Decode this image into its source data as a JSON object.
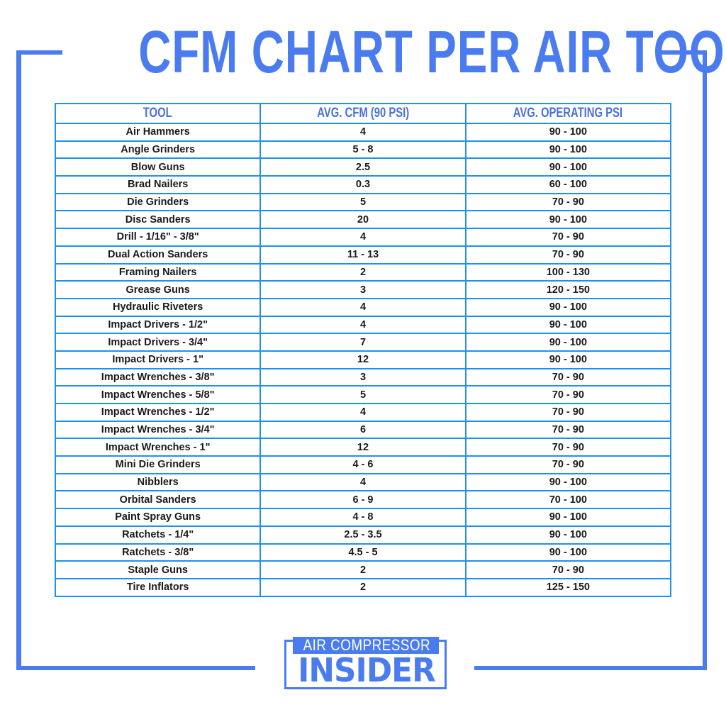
{
  "title": "CFM CHART PER AIR TOOL",
  "colors": {
    "brand_blue": "#4a7cf0",
    "grid_blue": "#1e90f0",
    "header_text": "#4a6fe0",
    "cell_text": "#1a1a1a"
  },
  "table": {
    "headers": [
      "TOOL",
      "AVG. CFM (90 PSI)",
      "AVG. OPERATING PSI"
    ],
    "rows": [
      [
        "Air Hammers",
        "4",
        "90 - 100"
      ],
      [
        "Angle Grinders",
        "5 - 8",
        "90 - 100"
      ],
      [
        "Blow Guns",
        "2.5",
        "90 - 100"
      ],
      [
        "Brad Nailers",
        "0.3",
        "60 - 100"
      ],
      [
        "Die Grinders",
        "5",
        "70 - 90"
      ],
      [
        "Disc Sanders",
        "20",
        "90 - 100"
      ],
      [
        "Drill - 1/16\" - 3/8\"",
        "4",
        "70 - 90"
      ],
      [
        "Dual Action Sanders",
        "11 - 13",
        "70 - 90"
      ],
      [
        "Framing Nailers",
        "2",
        "100 - 130"
      ],
      [
        "Grease Guns",
        "3",
        "120 - 150"
      ],
      [
        "Hydraulic Riveters",
        "4",
        "90 - 100"
      ],
      [
        "Impact Drivers - 1/2\"",
        "4",
        "90 - 100"
      ],
      [
        "Impact Drivers - 3/4\"",
        "7",
        "90 - 100"
      ],
      [
        "Impact Drivers - 1\"",
        "12",
        "90 - 100"
      ],
      [
        "Impact Wrenches - 3/8\"",
        "3",
        "70 - 90"
      ],
      [
        "Impact Wrenches - 5/8\"",
        "5",
        "70 - 90"
      ],
      [
        "Impact Wrenches - 1/2\"",
        "4",
        "70 - 90"
      ],
      [
        "Impact Wrenches - 3/4\"",
        "6",
        "70 - 90"
      ],
      [
        "Impact Wrenches - 1\"",
        "12",
        "70 - 90"
      ],
      [
        "Mini Die Grinders",
        "4 - 6",
        "70 - 90"
      ],
      [
        "Nibblers",
        "4",
        "90 - 100"
      ],
      [
        "Orbital Sanders",
        "6 - 9",
        "70 - 100"
      ],
      [
        "Paint Spray Guns",
        "4 - 8",
        "90 - 100"
      ],
      [
        "Ratchets - 1/4\"",
        "2.5 - 3.5",
        "90 - 100"
      ],
      [
        "Ratchets - 3/8\"",
        "4.5 - 5",
        "90 - 100"
      ],
      [
        "Staple Guns",
        "2",
        "70 - 90"
      ],
      [
        "Tire Inflators",
        "2",
        "125 - 150"
      ]
    ]
  },
  "logo": {
    "top_text": "AIR COMPRESSOR",
    "main_text": "INSIDER"
  }
}
